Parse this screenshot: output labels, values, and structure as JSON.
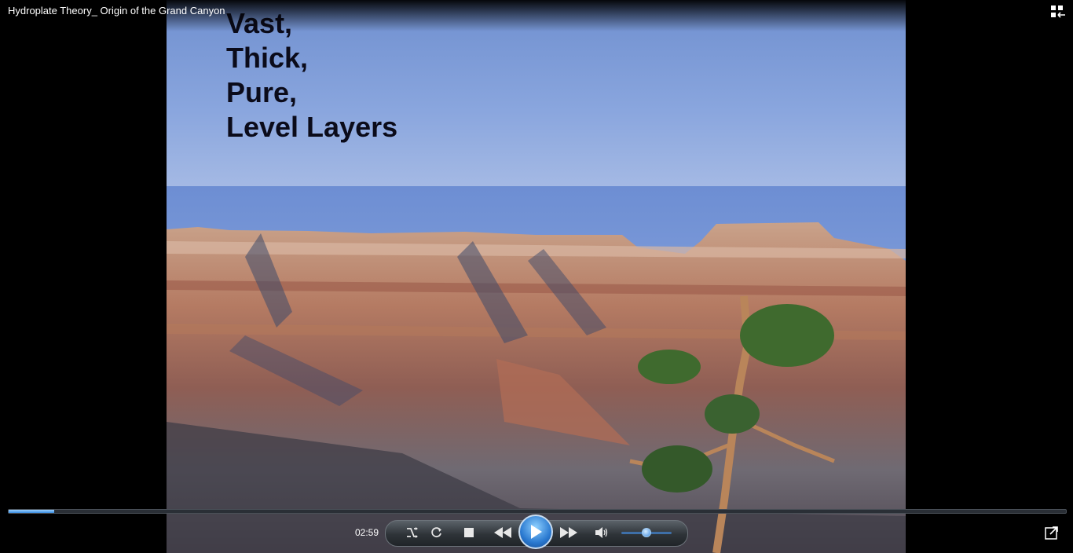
{
  "window": {
    "title": "Hydroplate Theory_ Origin of the Grand Canyon"
  },
  "slide": {
    "lines": [
      "Vast,",
      "Thick,",
      "Pure,",
      "Level Layers"
    ]
  },
  "player": {
    "elapsed": "02:59",
    "progress": 0.043,
    "volume": 0.5,
    "accent_color": "#3a8de0",
    "icons": [
      "switch-to-library-icon",
      "shuffle-icon",
      "repeat-icon",
      "stop-icon",
      "previous-icon",
      "play-icon",
      "next-icon",
      "volume-icon",
      "fullscreen-icon"
    ]
  }
}
